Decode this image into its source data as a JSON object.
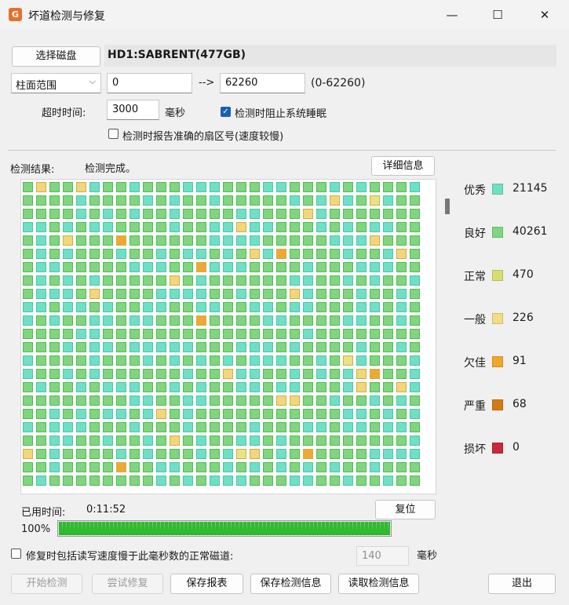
{
  "window": {
    "title": "坏道检测与修复",
    "icon_name": "app-logo-icon",
    "icon_glyph": "G",
    "minimize_glyph": "—",
    "maximize_glyph": "☐",
    "close_glyph": "✕"
  },
  "disk": {
    "select_button": "选择磁盘",
    "name": "HD1:SABRENT(477GB)"
  },
  "range": {
    "mode": "柱面范围",
    "start": "0",
    "arrow": "-->",
    "end": "62260",
    "hint": "(0-62260)"
  },
  "timeout": {
    "label": "超时时间:",
    "value": "3000",
    "unit": "毫秒"
  },
  "options": {
    "prevent_sleep": "检测时阻止系统睡眠",
    "prevent_sleep_checked": true,
    "report_sector": "检测时报告准确的扇区号(速度较慢)",
    "report_sector_checked": false
  },
  "result": {
    "label": "检测结果:",
    "status": "检测完成。",
    "details_button": "详细信息"
  },
  "grid": {
    "rows": 23,
    "cols": 30,
    "colors": {
      "excellent": "#6ee0c4",
      "good": "#7fd67f",
      "normal": "#e8e384",
      "fair": "#f2d67a",
      "poor": "#f0a830",
      "severe": "#d47c12",
      "damaged": "#c8283c"
    }
  },
  "legend": [
    {
      "label": "优秀",
      "color": "#6ee0c4",
      "count": "21145"
    },
    {
      "label": "良好",
      "color": "#7fd67f",
      "count": "40261"
    },
    {
      "label": "正常",
      "color": "#d9dc72",
      "count": "470"
    },
    {
      "label": "一般",
      "color": "#f4dc84",
      "count": "226"
    },
    {
      "label": "欠佳",
      "color": "#f2a72a",
      "count": "91"
    },
    {
      "label": "严重",
      "color": "#d47c12",
      "count": "68"
    },
    {
      "label": "损坏",
      "color": "#c8283c",
      "count": "0"
    }
  ],
  "elapsed": {
    "label": "已用时间:",
    "value": "0:11:52",
    "reset_button": "复位"
  },
  "progress": {
    "percent_text": "100%",
    "value": 1.0
  },
  "repair_option": {
    "label": "修复时包括读写速度慢于此毫秒数的正常磁道:",
    "checked": false,
    "value": "140",
    "unit": "毫秒"
  },
  "buttons": {
    "start": "开始检测",
    "try_repair": "尝试修复",
    "save_report": "保存报表",
    "save_info": "保存检测信息",
    "load_info": "读取检测信息",
    "exit": "退出"
  }
}
